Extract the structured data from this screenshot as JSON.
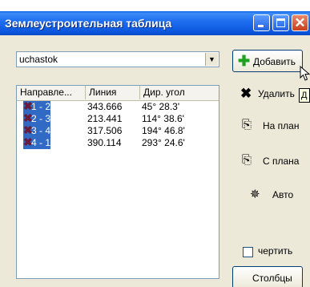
{
  "window": {
    "title": "Землеустроительная таблица"
  },
  "combo": {
    "value": "uchastok"
  },
  "listview": {
    "columns": [
      "Направле...",
      "Линия",
      "Дир. угол"
    ],
    "rows": [
      {
        "direction": "1 - 2",
        "line": "343.666",
        "angle": "45° 28.3'"
      },
      {
        "direction": "2 - 3",
        "line": "213.441",
        "angle": "114° 38.6'"
      },
      {
        "direction": "3 - 4",
        "line": "317.506",
        "angle": "194° 46.8'"
      },
      {
        "direction": "4 - 1",
        "line": "390.114",
        "angle": "293° 24.6'"
      }
    ]
  },
  "buttons": {
    "add": "Добавить",
    "delete": "Удалить",
    "to_plan": "На план",
    "from_plan": "С плана",
    "auto": "Авто",
    "draw": "чертить",
    "columns": "Столбцы"
  },
  "tooltip": {
    "text": "Д"
  },
  "colors": {
    "selection": "#316ac5",
    "titlebar": "#0b55dc",
    "add_icon": "#1fa01f"
  }
}
